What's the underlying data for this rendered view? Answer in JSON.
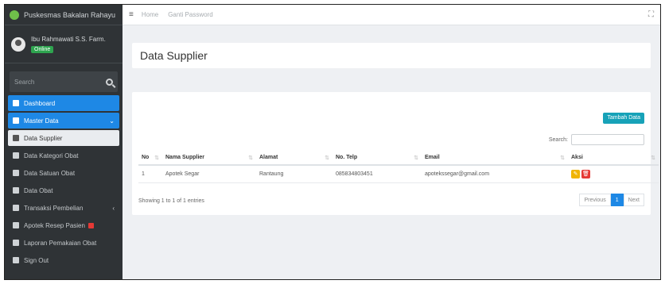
{
  "brand": {
    "title": "Puskesmas Bakalan Rahayu"
  },
  "user": {
    "name": "Ibu Rahmawati S.S. Farm.",
    "status": "Online"
  },
  "sidebar": {
    "search_placeholder": "Search",
    "items": [
      {
        "label": "Dashboard",
        "icon": "dashboard-icon"
      },
      {
        "label": "Master Data",
        "icon": "database-icon"
      },
      {
        "label": "Data Supplier",
        "icon": "file-icon"
      },
      {
        "label": "Data Kategori Obat",
        "icon": "users-icon"
      },
      {
        "label": "Data Satuan Obat",
        "icon": "users-icon"
      },
      {
        "label": "Data Obat",
        "icon": "users-icon"
      },
      {
        "label": "Transaksi Pembelian",
        "icon": "cart-icon"
      },
      {
        "label": "Apotek Resep Pasien",
        "icon": "file-icon"
      },
      {
        "label": "Laporan Pemakaian Obat",
        "icon": "download-icon"
      },
      {
        "label": "Sign Out",
        "icon": "signout-icon"
      }
    ]
  },
  "topbar": {
    "home": "Home",
    "link2": "Ganti Password"
  },
  "page": {
    "title": "Data Supplier"
  },
  "card": {
    "add_button": "Tambah Data",
    "search_label": "Search:",
    "columns": [
      "No",
      "Nama Supplier",
      "Alamat",
      "No. Telp",
      "Email",
      "Aksi"
    ],
    "rows": [
      {
        "no": "1",
        "nama": "Apotek Segar",
        "alamat": "Rantaung",
        "telp": "085834803451",
        "email": "apotekssegar@gmail.com"
      }
    ],
    "info": "Showing 1 to 1 of 1 entries",
    "pager": {
      "prev": "Previous",
      "page": "1",
      "next": "Next"
    }
  }
}
